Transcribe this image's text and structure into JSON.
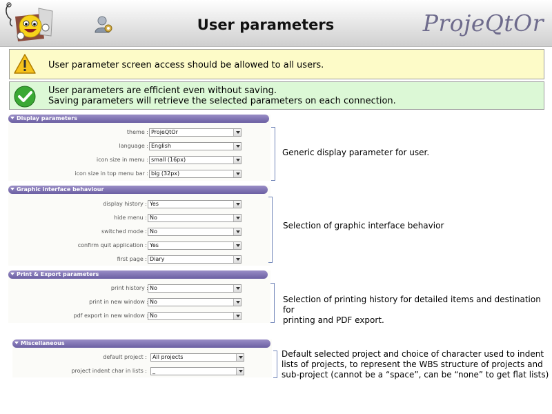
{
  "header": {
    "title": "User parameters",
    "brand": "ProjeQtOr",
    "icons": {
      "mascot": "projeqtor-mascot-icon",
      "user": "user-parameters-icon"
    }
  },
  "banners": {
    "warning": {
      "icon": "warning-icon",
      "text": "User parameter screen access should be allowed to all users."
    },
    "success": {
      "icon": "checkmark-icon",
      "line1": "User parameters are efficient even without saving.",
      "line2": "Saving parameters will retrieve the selected parameters on each connection."
    }
  },
  "sections": {
    "display": {
      "title": "Display parameters",
      "fields": [
        {
          "label": "theme :",
          "value": "ProjeQtOr"
        },
        {
          "label": "language :",
          "value": "English"
        },
        {
          "label": "icon size in menu :",
          "value": "small (16px)"
        },
        {
          "label": "icon size in top menu bar :",
          "value": "big (32px)"
        }
      ],
      "note": "Generic display parameter for user."
    },
    "graphic": {
      "title": "Graphic interface behaviour",
      "fields": [
        {
          "label": "display history :",
          "value": "Yes"
        },
        {
          "label": "hide menu :",
          "value": "No"
        },
        {
          "label": "switched mode :",
          "value": "No"
        },
        {
          "label": "confirm quit application :",
          "value": "Yes"
        },
        {
          "label": "first page :",
          "value": "Diary"
        }
      ],
      "note": "Selection of graphic interface behavior"
    },
    "print": {
      "title": "Print & Export parameters",
      "fields": [
        {
          "label": "print history :",
          "value": "No"
        },
        {
          "label": "print in new window :",
          "value": "No"
        },
        {
          "label": "pdf export in new window :",
          "value": "No"
        }
      ],
      "note_line1": "Selection of printing history for detailed items and destination for",
      "note_line2": "printing and PDF export."
    },
    "misc": {
      "title": "Miscellaneous",
      "fields": [
        {
          "label": "default project :",
          "value": "All projects"
        },
        {
          "label": "project indent char in lists :",
          "value": "_"
        }
      ],
      "note_line1": "Default selected project and choice of character used to indent",
      "note_line2": "lists of projects, to represent the WBS structure of projects and",
      "note_line3": "sub-project (cannot be a “space”, can be “none” to get flat lists)"
    }
  },
  "colors": {
    "section_header": "#6b5fa2",
    "warning_bg": "#fdfbc8",
    "success_bg": "#dcf8d6",
    "brand": "#6e6b8c",
    "bracket": "#6f84b8"
  }
}
